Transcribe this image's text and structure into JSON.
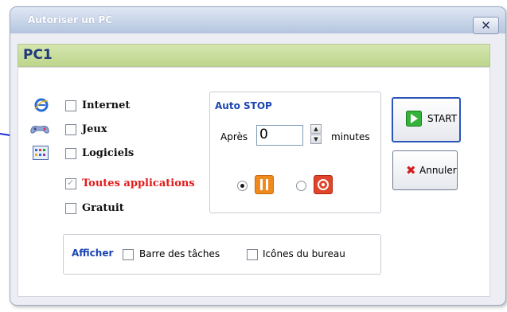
{
  "window": {
    "title": "Autoriser un PC"
  },
  "header": {
    "title": "PC1"
  },
  "options": [
    {
      "label": "Internet",
      "checked": false,
      "icon": "internet-explorer-icon"
    },
    {
      "label": "Jeux",
      "checked": false,
      "icon": "game-controller-icon"
    },
    {
      "label": "Logiciels",
      "checked": false,
      "icon": "applications-grid-icon"
    },
    {
      "label": "Toutes applications",
      "checked": true,
      "color": "#e31a1a"
    },
    {
      "label": "Gratuit",
      "checked": false
    }
  ],
  "autostop": {
    "title": "Auto STOP",
    "after_label": "Après",
    "value": "0",
    "unit_label": "minutes",
    "modes": [
      {
        "icon": "pause-icon",
        "selected": true
      },
      {
        "icon": "stop-icon",
        "selected": false
      }
    ]
  },
  "buttons": {
    "start": "START",
    "cancel": "Annuler"
  },
  "afficher": {
    "title": "Afficher",
    "items": [
      {
        "label": "Barre des tâches",
        "checked": false
      },
      {
        "label": "Icônes du bureau",
        "checked": false
      }
    ]
  },
  "colors": {
    "header_band": "#c6dc98",
    "accent_blue": "#1b45b3",
    "pause": "#f08a1c",
    "stop": "#e0442a",
    "start": "#34b33a"
  }
}
